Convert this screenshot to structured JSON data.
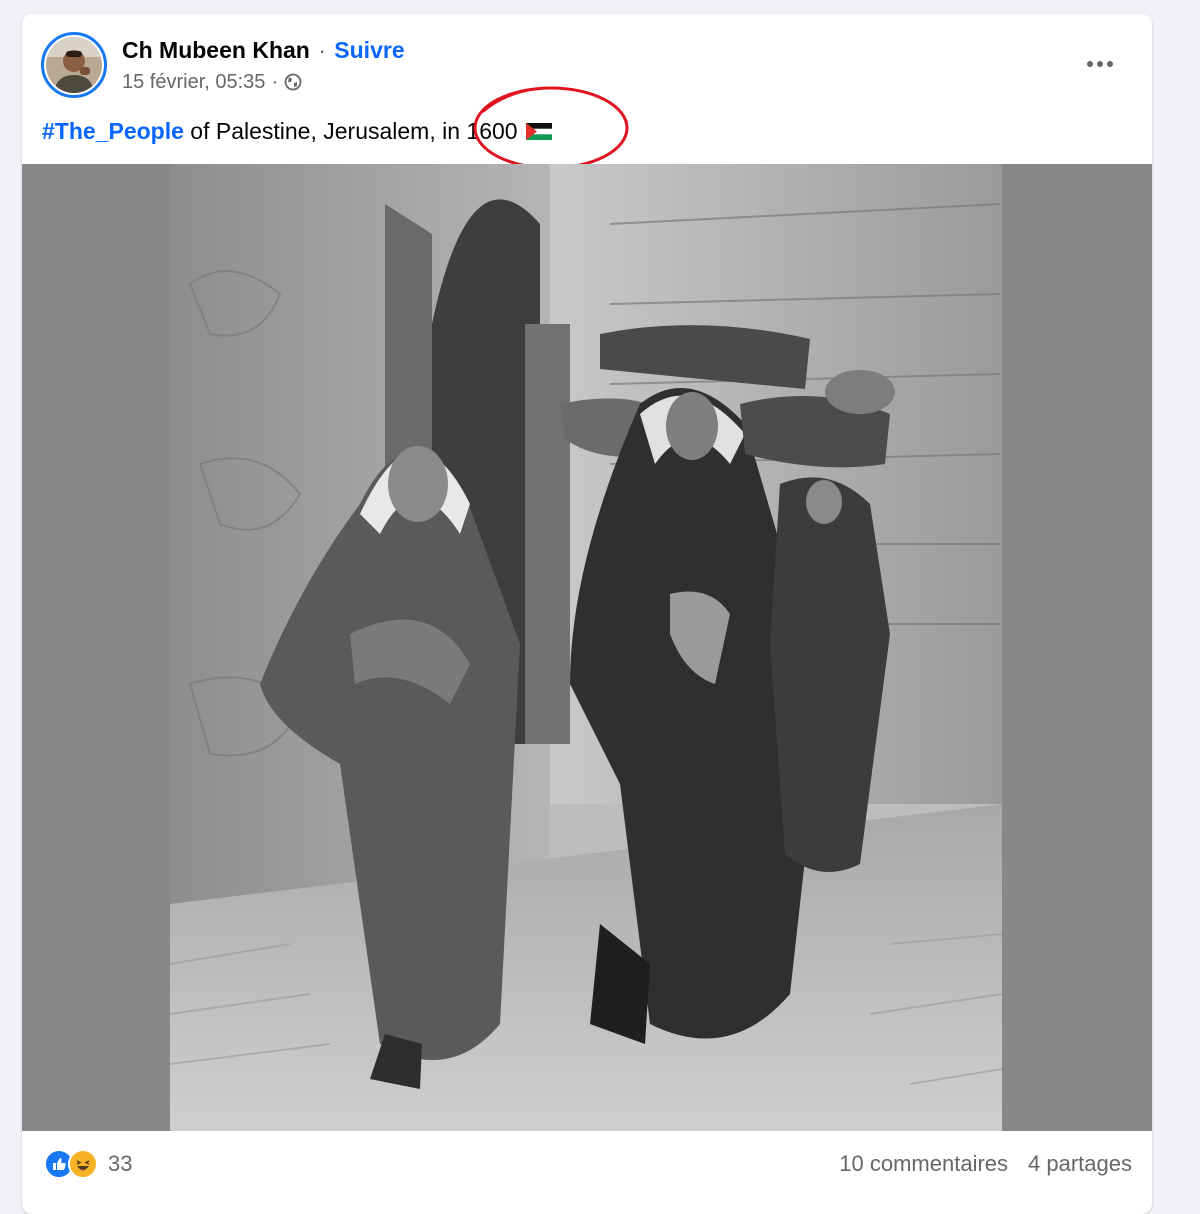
{
  "post": {
    "author_name": "Ch Mubeen Khan",
    "separator": "·",
    "follow_label": "Suivre",
    "timestamp": "15 février, 05:35",
    "meta_separator": "·",
    "privacy_icon": "globe-icon",
    "more_icon": "more-options-icon",
    "caption": {
      "hashtag": "#The_People",
      "text": " of Palestine, Jerusalem, in 1600",
      "emoji_icon": "palestine-flag-icon"
    },
    "annotation": {
      "type": "red-hand-drawn-ellipse",
      "color": "#e0141e"
    },
    "photo": {
      "description_icon": "black-and-white-photo",
      "background_color": "#888888"
    }
  },
  "footer": {
    "reaction_icons": [
      "like-icon",
      "haha-icon"
    ],
    "reaction_count": "33",
    "comments": "10 commentaires",
    "shares": "4 partages"
  },
  "colors": {
    "accent": "#0866ff",
    "secondary_text": "#65676b",
    "like_blue": "#1877f2",
    "haha_yellow": "#f7b125"
  }
}
